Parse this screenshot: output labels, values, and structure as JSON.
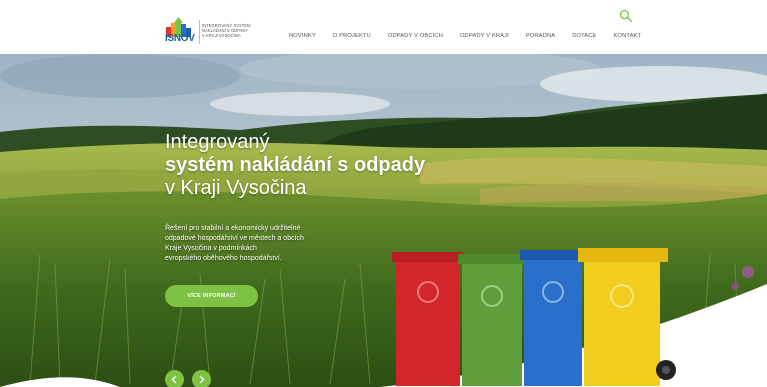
{
  "logo": {
    "word": "ISNOV",
    "lines": [
      "INTEGROVANÝ SYSTÉM",
      "NAKLÁDÁNÍ S ODPADY",
      "V KRAJI VYSOČINA"
    ]
  },
  "nav": {
    "items": [
      "NOVINKY",
      "O PROJEKTU",
      "ODPADY V OBCÍCH",
      "ODPADY V KRAJI",
      "PORADNA",
      "DOTACE",
      "KONTAKT"
    ]
  },
  "hero": {
    "title_line1": "Integrovaný",
    "title_line2": "systém nakládání s odpady",
    "title_line3": "v Kraji Vysočina",
    "description_lines": [
      "Řešení pro stabilní a ekonomicky udržitelné",
      "odpadové hospodářství ve městech a obcích",
      "Kraje Vysočina v podmínkách",
      "evropského oběhového hospodářství."
    ],
    "cta_label": "VÍCE INFORMACÍ"
  },
  "icons": {
    "search": "search-icon",
    "prev": "chevron-left-icon",
    "next": "chevron-right-icon",
    "recycle": "recycle-icon"
  },
  "colors": {
    "accent": "#7dc242",
    "brand": "#1b5fa8",
    "bin_red": "#d3262b",
    "bin_green": "#5f9e3a",
    "bin_blue": "#2a6fc9",
    "bin_yellow": "#f1cd1e"
  }
}
